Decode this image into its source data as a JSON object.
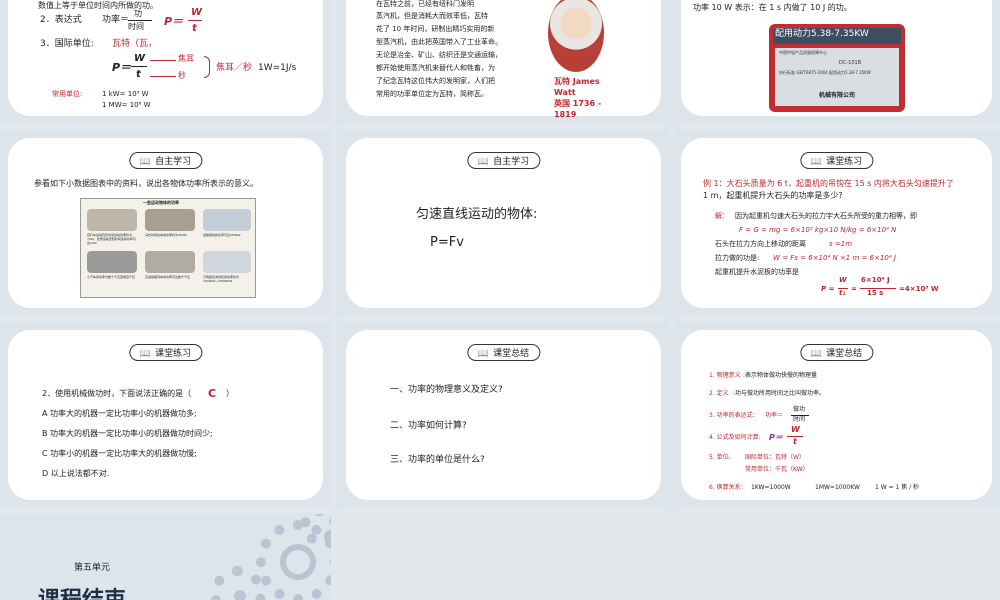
{
  "slide1": {
    "top_text": "数值上等于单位时间内所做的功。",
    "item2_prefix": "2．表达式",
    "power_label": "功率＝",
    "frac_num": "功",
    "frac_den": "时间",
    "formula_P": "P＝",
    "formula_W": "W",
    "formula_t": "t",
    "item3_prefix": "3．国际单位:",
    "item3_unit": "瓦特（瓦，",
    "unit_P": "P＝",
    "unit_W": "W",
    "unit_t": "t",
    "arrow_jiao": "焦耳",
    "arrow_miao": "秒",
    "jiao_per_sec": "焦耳／秒",
    "one_w": "1W=1J/s",
    "common_label": "常用单位:",
    "kw": "1 kW= 10³ W",
    "mw": "1 MW= 10⁶ W"
  },
  "slide2": {
    "lines": [
      "蒸汽机，但是消耗大而效率低，瓦特",
      "花了 10 年时间，研制出精巧实用的新",
      "型蒸汽机，由此把英国带入了工业革命。",
      "无论是冶金、矿山、纺织还是交通运输，",
      "都开始使用蒸汽机来替代人和牲畜，为",
      "了纪念瓦特这位伟大的发明家，人们把",
      "常用的功率单位定为瓦特，简称瓦。"
    ],
    "top_partial": "在瓦特之前，已经有纽科门发明",
    "portrait_name": "瓦特 James",
    "portrait_name2": "Watt",
    "portrait_life": "英国  1736 -",
    "portrait_life2": "1819"
  },
  "slide3": {
    "text": "功率 10 W 表示：在 1 s 内做了 10 J 的功。",
    "plate_title": "配用动力5.38-7.35KW",
    "plate_company": "机械有限公司",
    "plate_model": "DC-101B",
    "plate_line1": "中国中轻产品质量保障中心",
    "plate_line2": "执行标准 GB/T6875-2004 配用动力5.38-7.35KW"
  },
  "slide4": {
    "tag": "自主学习",
    "text": "参看如下小数据图表中的资料，说出各物体功率所表示的意义。",
    "img_title": "一些运动物体的功率",
    "captions": [
      "自行车运动员长时间运动功率约为70W，优秀运动员短时间运动功率可达1kW",
      "马长时间拉车的功率约为450W",
      "蓝鲸游动的功率可达350kW",
      "小汽车的功率为数十千瓦至两百千瓦",
      "高速铁路列车的功率可达数千千瓦",
      "万吨级远洋货轮的功率约为7000kW~23000kW"
    ]
  },
  "slide5": {
    "tag": "自主学习",
    "line1": "匀速直线运动的物体:",
    "line2": "P=Fv"
  },
  "slide6": {
    "tag": "课堂练习",
    "example": "例 1：大石头质量为 6 t，起重机的吊钩在 15 s 内将大石头匀速提升了",
    "example2": "1 m，起重机提升大石头的功率是多少?",
    "sol": "解：",
    "sol_text": "因为起重机匀速大石头的拉力宇大石头所受的重力相等，即",
    "eq1": "F = G = mg = 6×10³ kg×10 N/kg = 6×10⁴ N",
    "dist": "石头在拉力方向上移动的距离",
    "dist_val": "s =1m",
    "work": "拉力做的功是:",
    "work_val": "W = Fs = 6×10⁴ N ×1 m = 6×10⁴ J",
    "power": "起重机提升水泥板的功率是",
    "p_lhs": "P =",
    "p_num": "W",
    "p_den": "t₁",
    "p_num2": "6×10⁴ J",
    "p_den2": "15 s",
    "p_rhs": "=4×10³ W"
  },
  "slide7": {
    "tag": "课堂练习",
    "q": "2．使用机械做功时，下面说法正确的是（",
    "answer": "C",
    "q_end": "）",
    "options": [
      "A 功率大的机器一定比功率小的机器做功多;",
      "B 功率大的机器一定比功率小的机器做功时间少;",
      "C 功率小的机器一定比功率大的机器做功慢;",
      "D 以上说法都不对."
    ]
  },
  "slide8": {
    "tag": "课堂总结",
    "items": [
      "一、功率的物理意义及定义?",
      "二、功率如何计算?",
      "三、功率的单位是什么?"
    ]
  },
  "slide9": {
    "tag": "课堂总结",
    "l1a": "1. 物理意义",
    "l1b": ":表示物体做功快慢的物理量",
    "l2a": "2. 定义",
    "l2b": ":功与做功所用时间之比叫做功率。",
    "l3a": "3. 功率的表达式：",
    "l3b": "功率＝",
    "l3num": "做功",
    "l3den": "时间",
    "l4a": "4. 公式及如何计算:",
    "l4b": "P＝",
    "l4num": "W",
    "l4den": "t",
    "l5a": "5. 单位:",
    "l5b": "国际单位：瓦特（W）",
    "l5c": "常用单位：千瓦（KW）",
    "l6a": "6. 换算关系：",
    "l6b": "1KW=1000W",
    "l6c": "1MW=1000KW",
    "l6d": "1 W = 1 焦 / 秒"
  },
  "slide10": {
    "unit": "第五单元",
    "end": "课程结束"
  },
  "colors": {
    "red": "#c0262d",
    "bg": "#dce4ec"
  }
}
